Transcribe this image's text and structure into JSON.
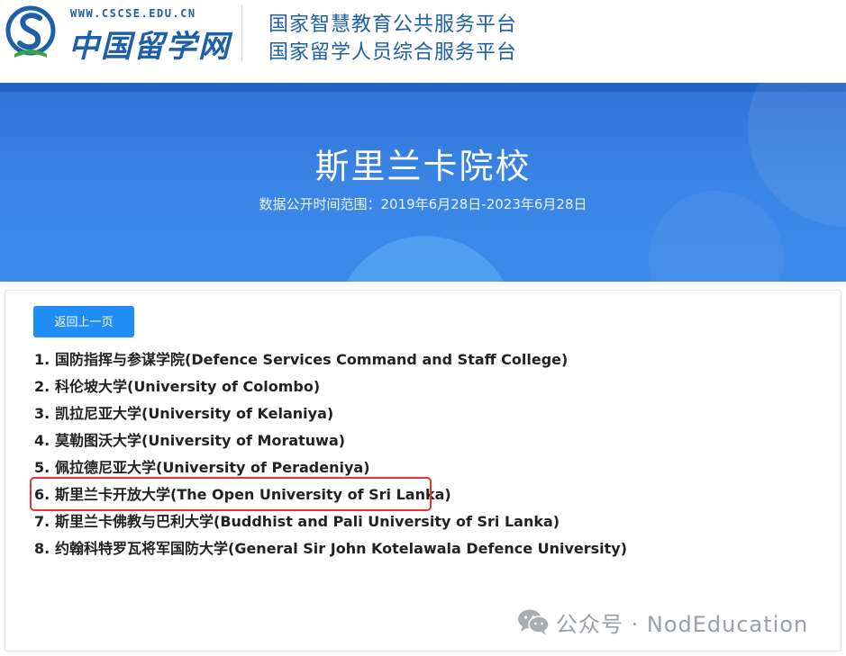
{
  "header": {
    "logo_url": "WWW.CSCSE.EDU.CN",
    "logo_text": "中国留学网",
    "platform_line1": "国家智慧教育公共服务平台",
    "platform_line2": "国家留学人员综合服务平台",
    "logo_icon": "cscse-logo-icon",
    "brand_color": "#1d5fa8"
  },
  "banner": {
    "title": "斯里兰卡院校",
    "subtitle": "数据公开时间范围：2019年6月28日-2023年6月28日",
    "color": "#3a86e6"
  },
  "content": {
    "back_button_label": "返回上一页",
    "universities": [
      {
        "num": "1.",
        "name": "国防指挥与参谋学院(Defence Services Command and Staff College)"
      },
      {
        "num": "2.",
        "name": "科伦坡大学(University of Colombo)"
      },
      {
        "num": "3.",
        "name": "凯拉尼亚大学(University of Kelaniya)"
      },
      {
        "num": "4.",
        "name": "莫勒图沃大学(University of Moratuwa)"
      },
      {
        "num": "5.",
        "name": "佩拉德尼亚大学(University of Peradeniya)"
      },
      {
        "num": "6.",
        "name": "斯里兰卡开放大学(The Open University of Sri Lanka)"
      },
      {
        "num": "7.",
        "name": "斯里兰卡佛教与巴利大学(Buddhist and Pali University of Sri Lanka)"
      },
      {
        "num": "8.",
        "name": "约翰科特罗瓦将军国防大学(General Sir John Kotelawala Defence University)"
      }
    ],
    "highlighted_item": 6,
    "highlight_color": "#e3342f",
    "button_color": "#1f8df5"
  },
  "watermark": {
    "icon": "wechat-icon",
    "text": "公众号 · NodEducation"
  }
}
